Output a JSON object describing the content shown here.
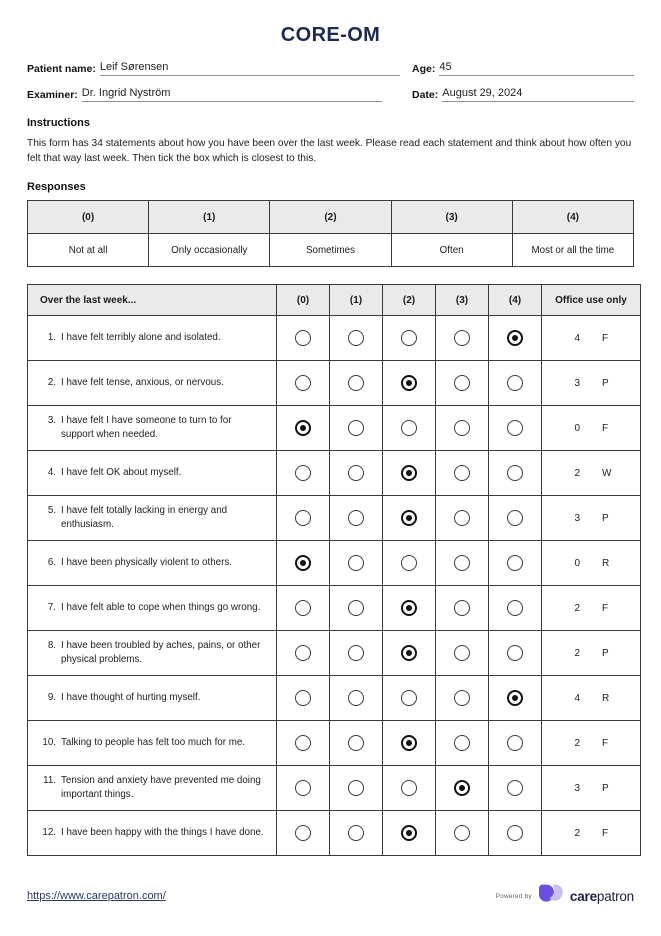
{
  "document": {
    "title": "CORE-OM"
  },
  "meta": {
    "patient_name_label": "Patient name:",
    "patient_name_value": "Leif Sørensen",
    "age_label": "Age:",
    "age_value": "45",
    "examiner_label": "Examiner:",
    "examiner_value": "Dr. Ingrid Nyström",
    "date_label": "Date:",
    "date_value": "August 29, 2024"
  },
  "instructions": {
    "heading": "Instructions",
    "text": "This form has 34 statements about how you have been over the last week. Please read each statement and think about how often you felt that way last week. Then tick the box which is closest to this."
  },
  "responses": {
    "heading": "Responses",
    "codes": [
      "(0)",
      "(1)",
      "(2)",
      "(3)",
      "(4)"
    ],
    "labels": [
      "Not at all",
      "Only occasionally",
      "Sometimes",
      "Often",
      "Most or all the time"
    ]
  },
  "items_table": {
    "statement_header": "Over the last week...",
    "option_headers": [
      "(0)",
      "(1)",
      "(2)",
      "(3)",
      "(4)"
    ],
    "office_header": "Office use only",
    "rows": [
      {
        "num": "1.",
        "text": "I have felt terribly alone and isolated.",
        "selected": 4,
        "score": "4",
        "dimension": "F"
      },
      {
        "num": "2.",
        "text": "I have felt tense, anxious, or nervous.",
        "selected": 2,
        "score": "3",
        "dimension": "P"
      },
      {
        "num": "3.",
        "text": "I have felt I have someone to turn to for support when needed.",
        "selected": 0,
        "score": "0",
        "dimension": "F"
      },
      {
        "num": "4.",
        "text": "I have felt OK about myself.",
        "selected": 2,
        "score": "2",
        "dimension": "W"
      },
      {
        "num": "5.",
        "text": "I have felt totally lacking in energy and enthusiasm.",
        "selected": 2,
        "score": "3",
        "dimension": "P"
      },
      {
        "num": "6.",
        "text": "I have been physically violent to others.",
        "selected": 0,
        "score": "0",
        "dimension": "R"
      },
      {
        "num": "7.",
        "text": "I have felt able to cope when things go wrong.",
        "selected": 2,
        "score": "2",
        "dimension": "F"
      },
      {
        "num": "8.",
        "text": "I have been troubled by aches, pains, or other physical problems.",
        "selected": 2,
        "score": "2",
        "dimension": "P"
      },
      {
        "num": "9.",
        "text": "I have thought of hurting myself.",
        "selected": 4,
        "score": "4",
        "dimension": "R"
      },
      {
        "num": "10.",
        "text": "Talking to people has felt too much for me.",
        "selected": 2,
        "score": "2",
        "dimension": "F"
      },
      {
        "num": "11.",
        "text": "Tension and anxiety have prevented me doing important things.",
        "selected": 3,
        "score": "3",
        "dimension": "P"
      },
      {
        "num": "12.",
        "text": "I have been happy with the things I have done.",
        "selected": 2,
        "score": "2",
        "dimension": "F"
      }
    ]
  },
  "footer": {
    "url": "https://www.carepatron.com/",
    "powered_by": "Powered by",
    "brand_bold": "care",
    "brand_light": "patron"
  },
  "colors": {
    "title": "#1c2a53",
    "header_fill": "#eaeaea",
    "brand_purple": "#6B4EE6",
    "brand_purple_light": "#C9BFF5"
  }
}
